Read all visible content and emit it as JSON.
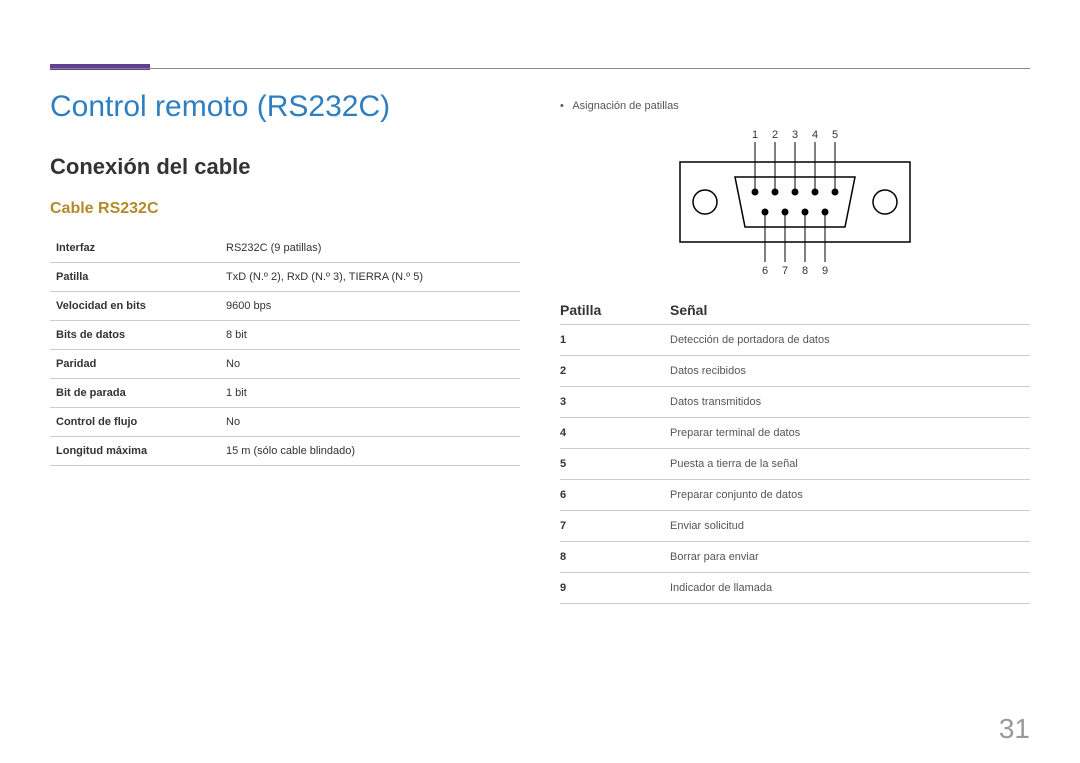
{
  "page_number": "31",
  "title": "Control remoto (RS232C)",
  "section_title": "Conexión del cable",
  "subsection_title": "Cable RS232C",
  "spec_table": [
    {
      "label": "Interfaz",
      "value": "RS232C (9 patillas)"
    },
    {
      "label": "Patilla",
      "value": "TxD (N.º 2), RxD (N.º 3), TIERRA (N.º 5)"
    },
    {
      "label": "Velocidad en bits",
      "value": "9600 bps"
    },
    {
      "label": "Bits de datos",
      "value": "8 bit"
    },
    {
      "label": "Paridad",
      "value": "No"
    },
    {
      "label": "Bit de parada",
      "value": "1 bit"
    },
    {
      "label": "Control de flujo",
      "value": "No"
    },
    {
      "label": "Longitud máxima",
      "value": "15 m (sólo cable blindado)"
    }
  ],
  "right_bullet": "Asignación de patillas",
  "connector": {
    "top_labels": [
      "1",
      "2",
      "3",
      "4",
      "5"
    ],
    "bottom_labels": [
      "6",
      "7",
      "8",
      "9"
    ]
  },
  "pin_header": {
    "a": "Patilla",
    "b": "Señal"
  },
  "pin_rows": [
    {
      "pin": "1",
      "signal": "Detección de portadora de datos"
    },
    {
      "pin": "2",
      "signal": "Datos recibidos"
    },
    {
      "pin": "3",
      "signal": "Datos transmitidos"
    },
    {
      "pin": "4",
      "signal": "Preparar terminal de datos"
    },
    {
      "pin": "5",
      "signal": "Puesta a tierra de la señal"
    },
    {
      "pin": "6",
      "signal": "Preparar conjunto de datos"
    },
    {
      "pin": "7",
      "signal": "Enviar solicitud"
    },
    {
      "pin": "8",
      "signal": "Borrar para enviar"
    },
    {
      "pin": "9",
      "signal": "Indicador de llamada"
    }
  ]
}
